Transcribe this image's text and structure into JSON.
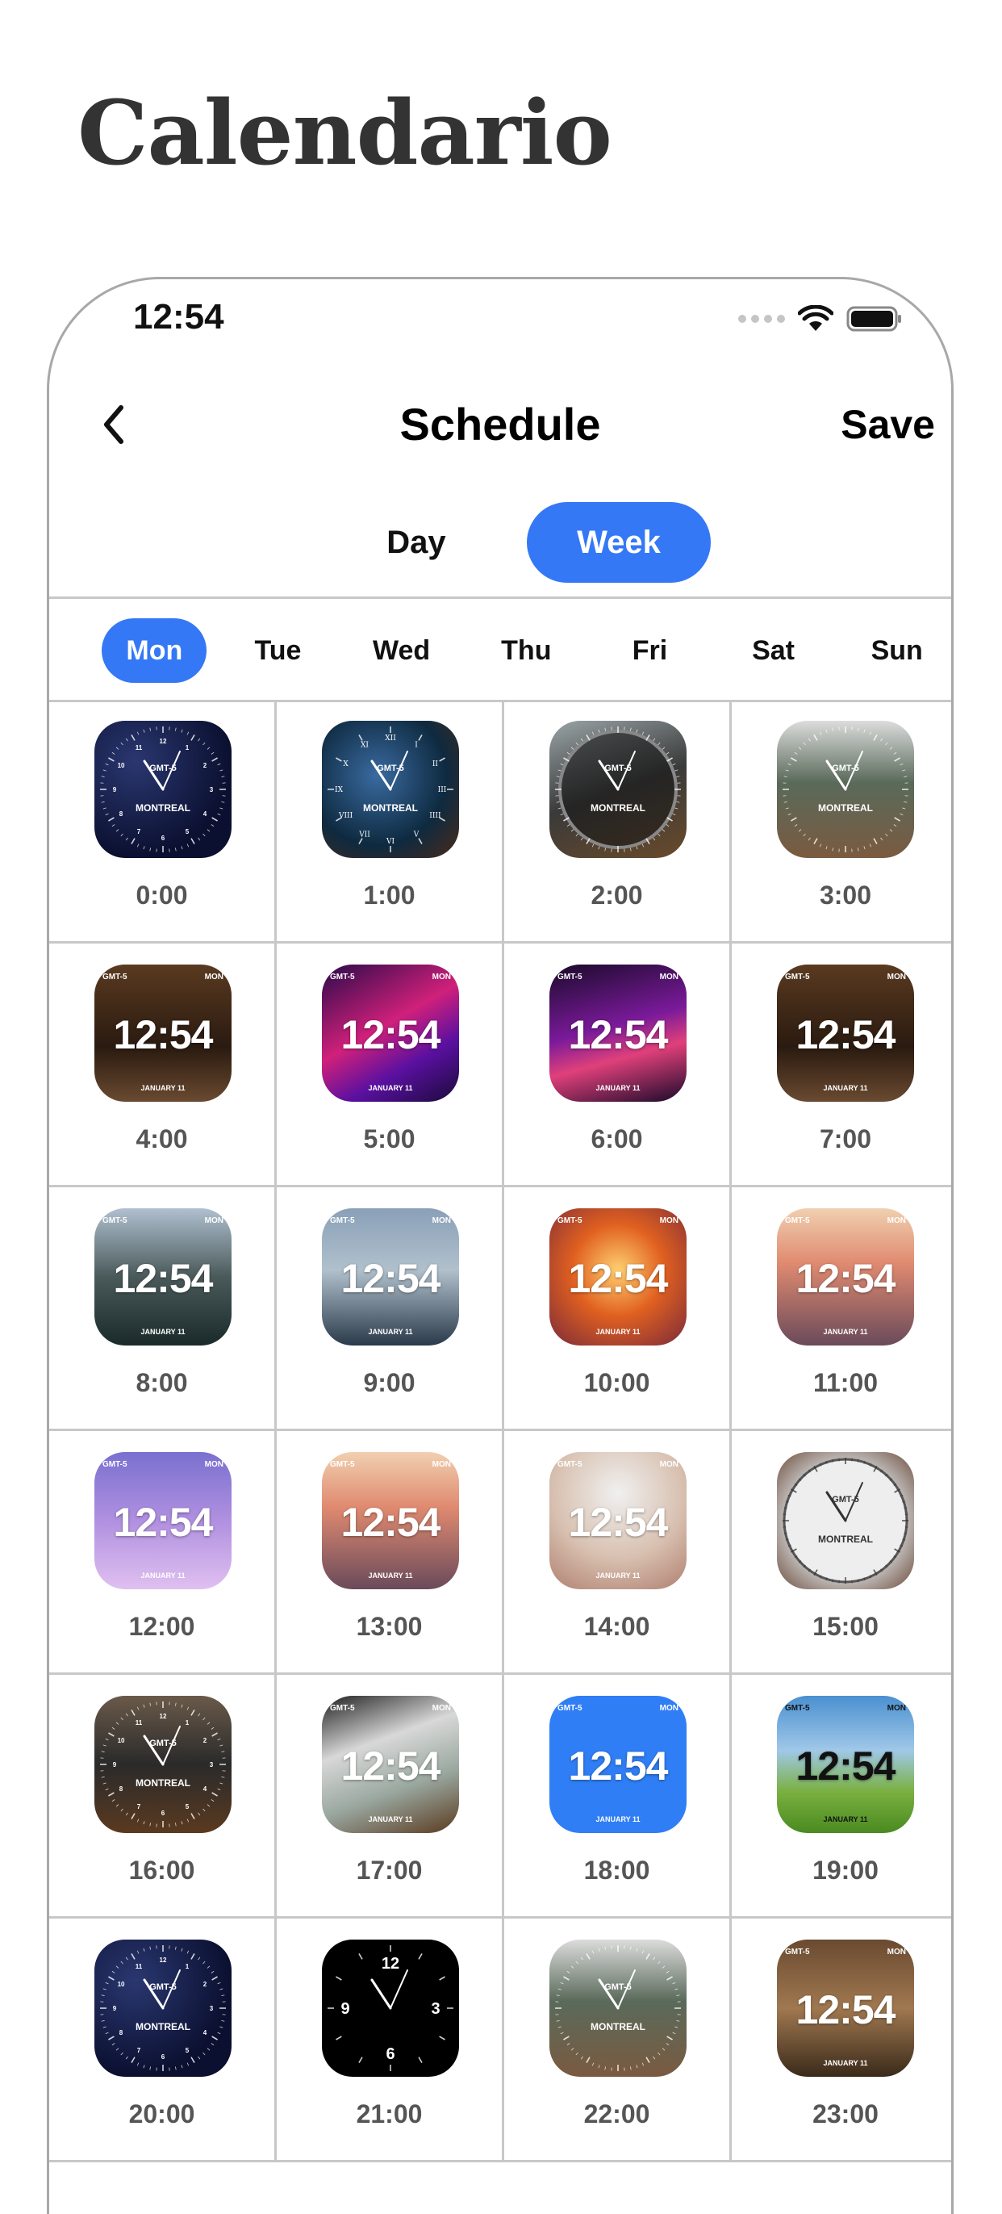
{
  "page_title": "Calendario",
  "status_bar": {
    "time": "12:54"
  },
  "nav": {
    "title": "Schedule",
    "save_label": "Save"
  },
  "segments": {
    "day": "Day",
    "week": "Week",
    "selected": "Week"
  },
  "days": [
    "Mon",
    "Tue",
    "Wed",
    "Thu",
    "Fri",
    "Sat",
    "Sun"
  ],
  "selected_day": "Mon",
  "accent_color": "#3578f6",
  "slots": [
    {
      "time": "0:00",
      "type": "analog",
      "bg": "radial-gradient(circle at 30% 30%, #2a3770 0%, #0b1030 70%)",
      "tz": "GMT-5",
      "city": "MONTREAL",
      "dial": "dark"
    },
    {
      "time": "1:00",
      "type": "analog",
      "bg": "radial-gradient(circle at 40% 40%, #3a6aa0 0%, #0e2a40 60%, #4a2a1a 100%)",
      "tz": "GMT-5",
      "city": "MONTREAL",
      "dial": "roman"
    },
    {
      "time": "2:00",
      "type": "analog",
      "bg": "linear-gradient(160deg, #9aa5a8 0%, #3a3a3a 50%, #6a4a2a 100%)",
      "tz": "GMT-5",
      "city": "MONTREAL",
      "dial": "ring"
    },
    {
      "time": "3:00",
      "type": "analog",
      "bg": "linear-gradient(180deg, #dcdcdc 0%, #5a6a5a 45%, #7a5a40 100%)",
      "tz": "GMT-5",
      "city": "MONTREAL",
      "dial": "plain"
    },
    {
      "time": "4:00",
      "type": "digital",
      "bg": "linear-gradient(180deg, #5a3a20 0%, #2a1a10 60%, #6a4a30 100%)",
      "tz": "GMT-5",
      "dow": "MON",
      "clock": "12:54",
      "date": "JANUARY 11"
    },
    {
      "time": "5:00",
      "type": "digital",
      "bg": "linear-gradient(150deg, #2a0a4a 0%, #d0207a 45%, #5a10a0 70%, #1a0a3a 100%)",
      "tz": "GMT-5",
      "dow": "MON",
      "clock": "12:54",
      "date": "JANUARY 11"
    },
    {
      "time": "6:00",
      "type": "digital",
      "bg": "linear-gradient(165deg, #1a0a2a 0%, #7a1a9a 45%, #e0407a 65%, #1a0a2a 100%)",
      "tz": "GMT-5",
      "dow": "MON",
      "clock": "12:54",
      "date": "JANUARY 11"
    },
    {
      "time": "7:00",
      "type": "digital",
      "bg": "linear-gradient(180deg, #5a3a20 0%, #2a1a10 60%, #6a4a30 100%)",
      "tz": "GMT-5",
      "dow": "MON",
      "clock": "12:54",
      "date": "JANUARY 11"
    },
    {
      "time": "8:00",
      "type": "digital",
      "bg": "linear-gradient(180deg, #b0c0d0 0%, #4a5a5a 50%, #1a2a2a 100%)",
      "tz": "GMT-5",
      "dow": "MON",
      "clock": "12:54",
      "date": "JANUARY 11"
    },
    {
      "time": "9:00",
      "type": "digital",
      "bg": "linear-gradient(180deg, #8aa0b8 0%, #b0c0cc 45%, #2a3a4a 100%)",
      "tz": "GMT-5",
      "dow": "MON",
      "clock": "12:54",
      "date": "JANUARY 11"
    },
    {
      "time": "10:00",
      "type": "digital",
      "bg": "radial-gradient(circle at 50% 45%, #ffd070 0%, #e06020 45%, #7a2a3a 100%)",
      "tz": "GMT-5",
      "dow": "MON",
      "clock": "12:54",
      "date": "JANUARY 11"
    },
    {
      "time": "11:00",
      "type": "digital",
      "bg": "linear-gradient(180deg, #f0d0b0 0%, #e08a70 40%, #6a4a5a 100%)",
      "tz": "GMT-5",
      "dow": "MON",
      "clock": "12:54",
      "date": "JANUARY 11"
    },
    {
      "time": "12:00",
      "type": "digital",
      "bg": "linear-gradient(180deg, #7a70d0 0%, #b090e0 50%, #e0c0f0 100%)",
      "tz": "GMT-5",
      "dow": "MON",
      "clock": "12:54",
      "date": "JANUARY 11"
    },
    {
      "time": "13:00",
      "type": "digital",
      "bg": "linear-gradient(180deg, #f0d0b0 0%, #e08a70 40%, #6a4a5a 100%)",
      "tz": "GMT-5",
      "dow": "MON",
      "clock": "12:54",
      "date": "JANUARY 11"
    },
    {
      "time": "14:00",
      "type": "digital",
      "bg": "radial-gradient(circle at 50% 30%, #f0f0f0 0%, #d8c0b0 55%, #b08070 100%)",
      "tz": "GMT-5",
      "dow": "MON",
      "clock": "12:54",
      "date": "JANUARY 11"
    },
    {
      "time": "15:00",
      "type": "analog",
      "bg": "radial-gradient(circle at 50% 50%, #f4f4f4 0%, #d0d0d0 55%, #6a4a3a 100%)",
      "tz": "GMT-5",
      "city": "MONTREAL",
      "dial": "light"
    },
    {
      "time": "16:00",
      "type": "analog",
      "bg": "linear-gradient(180deg, #6a5a4a 0%, #2a2a2a 50%, #5a3a20 100%)",
      "tz": "GMT-5",
      "city": "MONTREAL",
      "dial": "dark"
    },
    {
      "time": "17:00",
      "type": "digital",
      "bg": "linear-gradient(160deg, #202020 0%, #d8d8d8 35%, #9aa8a0 65%, #5a3a20 100%)",
      "tz": "GMT-5",
      "dow": "MON",
      "clock": "12:54",
      "date": "JANUARY 11"
    },
    {
      "time": "18:00",
      "type": "digital",
      "bg": "#2f7ef5",
      "tz": "GMT-5",
      "dow": "MON",
      "clock": "12:54",
      "date": "JANUARY 11"
    },
    {
      "time": "19:00",
      "type": "digital",
      "bg": "linear-gradient(180deg, #4a90d0 0%, #a0c8e8 40%, #7ab040 70%, #4a8a20 100%)",
      "tz": "GMT-5",
      "dow": "MON",
      "clock": "12:54",
      "date": "JANUARY 11",
      "dark_text": true
    },
    {
      "time": "20:00",
      "type": "analog",
      "bg": "radial-gradient(circle at 30% 30%, #2a3770 0%, #0b1030 70%)",
      "tz": "GMT-5",
      "city": "MONTREAL",
      "dial": "dark"
    },
    {
      "time": "21:00",
      "type": "analog",
      "bg": "#000000",
      "tz": "",
      "city": "",
      "dial": "numbers"
    },
    {
      "time": "22:00",
      "type": "analog",
      "bg": "linear-gradient(180deg, #dcdcdc 0%, #5a6a5a 45%, #7a5a40 100%)",
      "tz": "GMT-5",
      "city": "MONTREAL",
      "dial": "plain"
    },
    {
      "time": "23:00",
      "type": "digital",
      "bg": "linear-gradient(180deg, #6a4a30 0%, #a07850 50%, #3a2a1a 100%)",
      "tz": "GMT-5",
      "dow": "MON",
      "clock": "12:54",
      "date": "JANUARY 11"
    }
  ]
}
